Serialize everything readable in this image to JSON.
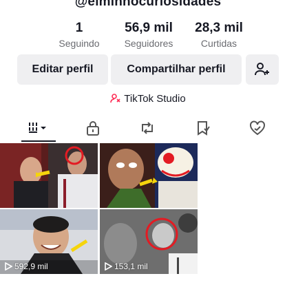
{
  "profile": {
    "handle": "@eiminnocuriosidades"
  },
  "stats": [
    {
      "value": "1",
      "label": "Seguindo"
    },
    {
      "value": "56,9 mil",
      "label": "Seguidores"
    },
    {
      "value": "28,3 mil",
      "label": "Curtidas"
    }
  ],
  "actions": {
    "edit_label": "Editar perfil",
    "share_label": "Compartilhar perfil",
    "add_friend_icon": "add-friend-icon"
  },
  "studio": {
    "label": "TikTok Studio",
    "icon": "studio-icon"
  },
  "tabs": [
    {
      "icon": "grid-icon",
      "active": true
    },
    {
      "icon": "lock-icon"
    },
    {
      "icon": "repost-icon"
    },
    {
      "icon": "bookmark-icon"
    },
    {
      "icon": "liked-icon"
    }
  ],
  "videos": [
    {
      "views": ""
    },
    {
      "views": ""
    },
    {
      "views": "592,9 mil"
    },
    {
      "views": "153,1 mil"
    }
  ],
  "colors": {
    "accent": "#fe2c55",
    "text": "#161823",
    "button_bg": "#efeff1",
    "muted": "#6a6b70"
  }
}
